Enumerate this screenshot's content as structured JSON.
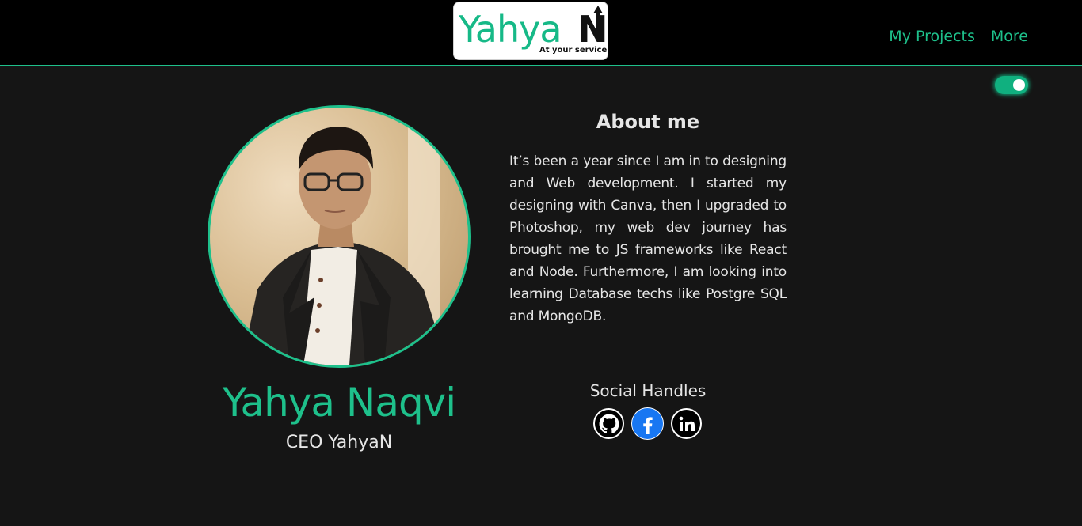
{
  "header": {
    "logo_text": "Yahya",
    "logo_n": "N",
    "logo_tagline": "At your service",
    "nav": [
      {
        "label": "My Projects"
      },
      {
        "label": "More"
      }
    ]
  },
  "theme_toggle": {
    "state": "on",
    "accent": "#10b07f"
  },
  "profile": {
    "name": "Yahya Naqvi",
    "role": "CEO YahyaN"
  },
  "about": {
    "title": "About me",
    "text": "It’s been a year since I am in to designing and Web development. I started my designing with Canva, then I upgraded to Photoshop, my web dev journey has brought me to JS frameworks like React and Node. Furthermore, I am looking into learning Database techs like Postgre SQL and MongoDB."
  },
  "social": {
    "title": "Social Handles",
    "icons": [
      "github-icon",
      "facebook-icon",
      "linkedin-icon"
    ]
  },
  "colors": {
    "accent": "#1ec08b",
    "background": "#151515",
    "header": "#000000",
    "text": "#e6e6e6"
  }
}
